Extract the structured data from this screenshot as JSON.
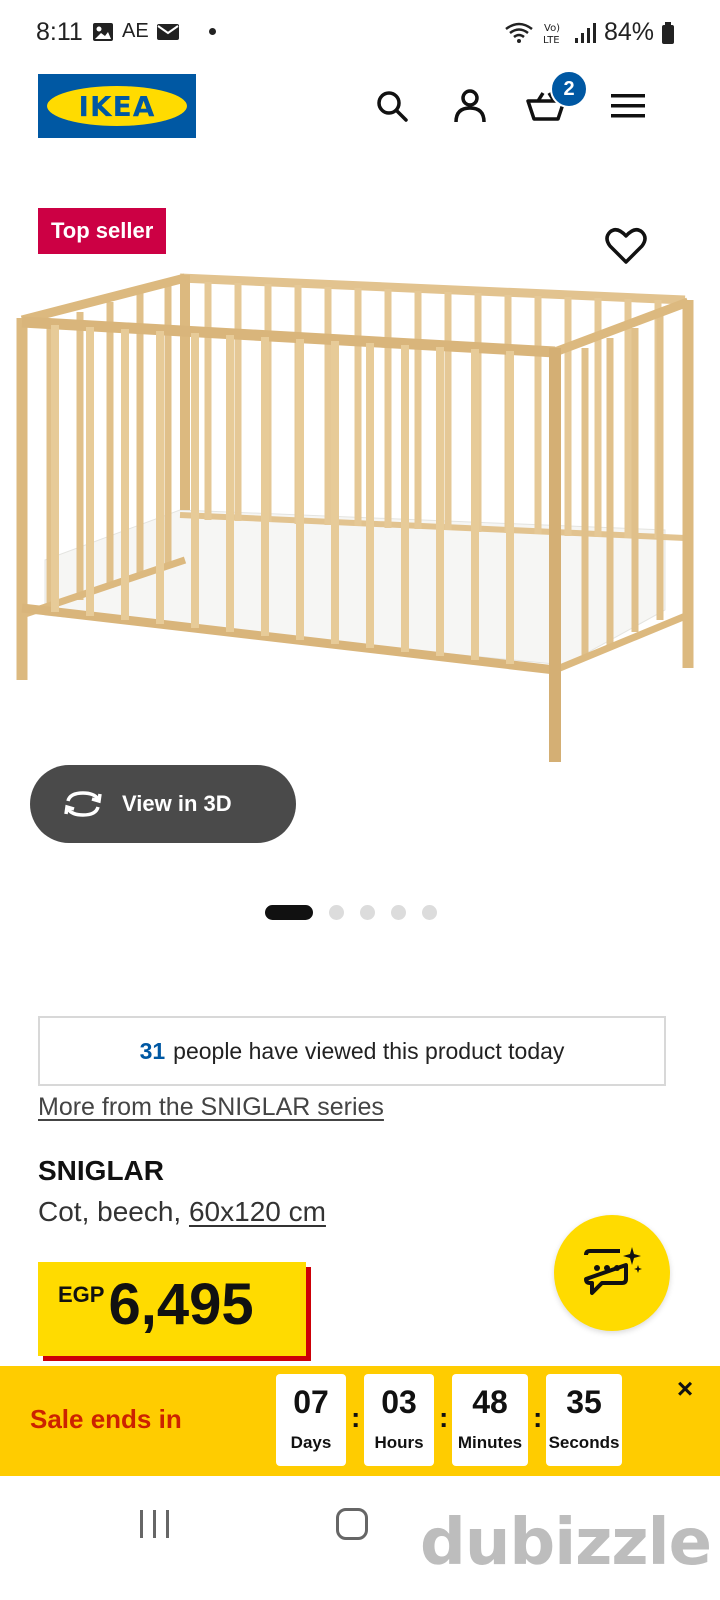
{
  "status_bar": {
    "time": "8:11",
    "carrier": "AE",
    "battery": "84%"
  },
  "header": {
    "logo_text": "IKEA",
    "cart_count": "2",
    "colors": {
      "brand_blue": "#0058a3",
      "brand_yellow": "#ffdb00"
    }
  },
  "gallery": {
    "badge": "Top seller",
    "view_3d_label": "View in 3D",
    "total_images": 5,
    "active_image": 1
  },
  "views": {
    "count": "31",
    "text": "people have viewed this product today"
  },
  "series_link": "More from the SNIGLAR series",
  "product": {
    "name": "SNIGLAR",
    "desc_prefix": "Cot, beech,",
    "size": "60x120 cm",
    "currency": "EGP",
    "price": "6,495"
  },
  "sale": {
    "label": "Sale ends in",
    "countdown": [
      {
        "value": "07",
        "unit": "Days"
      },
      {
        "value": "03",
        "unit": "Hours"
      },
      {
        "value": "48",
        "unit": "Minutes"
      },
      {
        "value": "35",
        "unit": "Seconds"
      }
    ],
    "close": "×"
  },
  "watermark": "dubizzle"
}
